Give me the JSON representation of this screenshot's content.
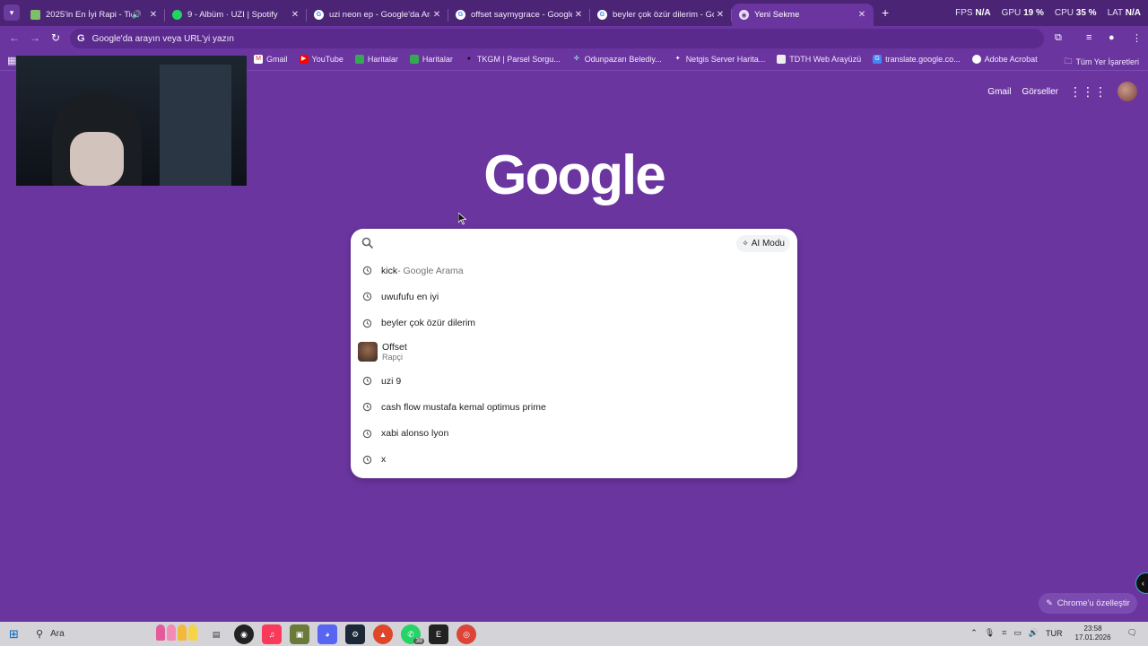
{
  "tabs": [
    {
      "title": "2025'in En İyi Rapi - Tier Lis",
      "favicon": "tier-list-favicon",
      "audio": true,
      "active": false
    },
    {
      "title": "9 - Albüm · UZI | Spotify",
      "favicon": "spotify-icon",
      "audio": false,
      "active": false
    },
    {
      "title": "uzi neon ep - Google'da Ara",
      "favicon": "google-icon",
      "audio": false,
      "active": false
    },
    {
      "title": "offset saymygrace - Google'da",
      "favicon": "google-icon",
      "audio": false,
      "active": false
    },
    {
      "title": "beyler çok özür dilerim - Googl",
      "favicon": "google-icon",
      "audio": false,
      "active": false
    },
    {
      "title": "Yeni Sekme",
      "favicon": "chrome-icon",
      "audio": false,
      "active": true
    }
  ],
  "overlay_stats": {
    "fps_label": "FPS",
    "fps_value": "N/A",
    "gpu_label": "GPU",
    "gpu_value": "19 %",
    "cpu_label": "CPU",
    "cpu_value": "35 %",
    "lat_label": "LAT",
    "lat_value": "N/A"
  },
  "omnibox": {
    "placeholder": "Google'da arayın veya URL'yi yazın"
  },
  "bookmarks": [
    {
      "label": "Gmail",
      "icon": "gmail-icon"
    },
    {
      "label": "YouTube",
      "icon": "youtube-icon"
    },
    {
      "label": "Haritalar",
      "icon": "maps-icon"
    },
    {
      "label": "Haritalar",
      "icon": "maps-icon"
    },
    {
      "label": "TKGM | Parsel Sorgu...",
      "icon": "location-pin-icon"
    },
    {
      "label": "Odunpazarı Belediy...",
      "icon": "municipality-icon"
    },
    {
      "label": "Netgis Server Harita...",
      "icon": "netgis-icon"
    },
    {
      "label": "TDTH Web Arayüzü",
      "icon": "tdth-icon"
    },
    {
      "label": "translate.google.co...",
      "icon": "translate-icon"
    },
    {
      "label": "Adobe Acrobat",
      "icon": "acrobat-icon"
    }
  ],
  "bookmarks_all": "Tüm Yer İşaretleri",
  "top_links": {
    "gmail": "Gmail",
    "images": "Görseller"
  },
  "logo_text": "Google",
  "search": {
    "value": "",
    "ai_mode_label": "AI Modu",
    "suggestions": [
      {
        "type": "history",
        "text": "kick",
        "suffix": " - Google Arama"
      },
      {
        "type": "history",
        "text": "uwufufu en iyi",
        "suffix": ""
      },
      {
        "type": "history",
        "text": "beyler çok özür dilerim",
        "suffix": ""
      },
      {
        "type": "entity",
        "text": "Offset",
        "subtitle": "Rapçi"
      },
      {
        "type": "history",
        "text": "uzi 9",
        "suffix": ""
      },
      {
        "type": "history",
        "text": "cash flow mustafa kemal optimus prime",
        "suffix": ""
      },
      {
        "type": "history",
        "text": "xabi alonso lyon",
        "suffix": ""
      },
      {
        "type": "history",
        "text": "x",
        "suffix": ""
      }
    ]
  },
  "customize_label": "Chrome'u özelleştir",
  "taskbar": {
    "search_placeholder": "Ara",
    "whatsapp_badge": "38",
    "lang": "TUR",
    "time": "23:58",
    "date": "17.01.2026"
  },
  "colors": {
    "background": "#6b35a0",
    "tabstrip": "#4b2475",
    "taskbar": "#d4d4d8"
  }
}
